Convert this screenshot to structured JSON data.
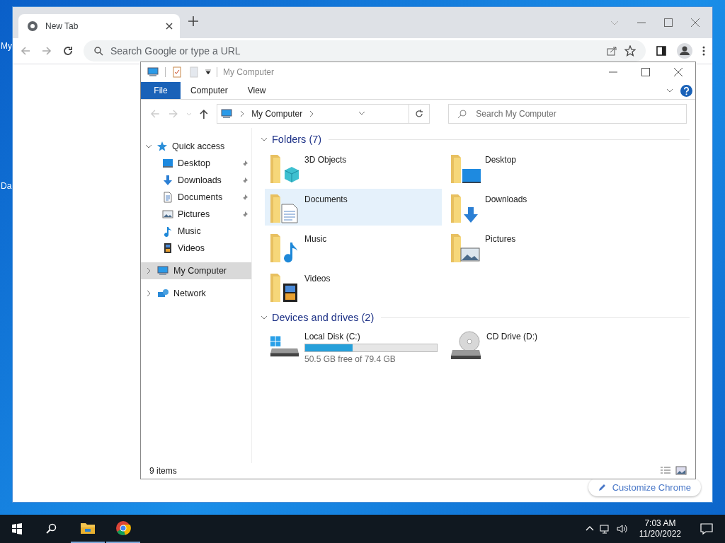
{
  "desktop": {
    "icon_labels": [
      "My",
      "Da"
    ]
  },
  "browser": {
    "tabs": [
      {
        "title": "New Tab",
        "selected": true
      }
    ],
    "address_placeholder": "Search Google or type a URL",
    "customize_button": "Customize Chrome"
  },
  "explorer": {
    "title": "My Computer",
    "ribbon_tabs": [
      {
        "label": "File",
        "selected": true
      },
      {
        "label": "Computer",
        "selected": false
      },
      {
        "label": "View",
        "selected": false
      }
    ],
    "breadcrumb": [
      "My Computer"
    ],
    "search_placeholder": "Search My Computer",
    "nav": [
      {
        "label": "Quick access",
        "kind": "star",
        "expanded": true,
        "selected": false,
        "children": [
          {
            "label": "Desktop",
            "kind": "desktop",
            "pinned": true,
            "selected": false
          },
          {
            "label": "Downloads",
            "kind": "downloads",
            "pinned": true,
            "selected": false
          },
          {
            "label": "Documents",
            "kind": "documents",
            "pinned": true,
            "selected": false
          },
          {
            "label": "Pictures",
            "kind": "pictures",
            "pinned": true,
            "selected": false
          },
          {
            "label": "Music",
            "kind": "music",
            "pinned": false,
            "selected": false
          },
          {
            "label": "Videos",
            "kind": "videos",
            "pinned": false,
            "selected": false
          }
        ]
      },
      {
        "label": "My Computer",
        "kind": "computer",
        "expanded": false,
        "selected": true
      },
      {
        "label": "Network",
        "kind": "network",
        "expanded": false,
        "selected": false
      }
    ],
    "groups": [
      {
        "title": "Folders (7)",
        "kind": "folders",
        "expanded": true,
        "items": [
          {
            "name": "3D Objects",
            "kind": "cube",
            "selected": false
          },
          {
            "name": "Desktop",
            "kind": "desktop",
            "selected": false
          },
          {
            "name": "Documents",
            "kind": "documents",
            "selected": true
          },
          {
            "name": "Downloads",
            "kind": "downloads",
            "selected": false
          },
          {
            "name": "Music",
            "kind": "music",
            "selected": false
          },
          {
            "name": "Pictures",
            "kind": "pictures",
            "selected": false
          },
          {
            "name": "Videos",
            "kind": "videos",
            "selected": false
          }
        ]
      },
      {
        "title": "Devices and drives (2)",
        "kind": "drives",
        "expanded": true,
        "items": [
          {
            "name": "Local Disk (C:)",
            "kind": "windows",
            "level": 0.36,
            "detail": "50.5 GB free of 79.4 GB",
            "selected": false
          },
          {
            "name": "CD Drive (D:)",
            "kind": "cd",
            "selected": false
          }
        ]
      }
    ],
    "status": "9 items"
  },
  "taskbar": {
    "apps": [
      {
        "kind": "folder",
        "running": true
      },
      {
        "kind": "chrome",
        "running": true
      }
    ],
    "time": "7:03 AM",
    "date": "11/20/2022"
  }
}
